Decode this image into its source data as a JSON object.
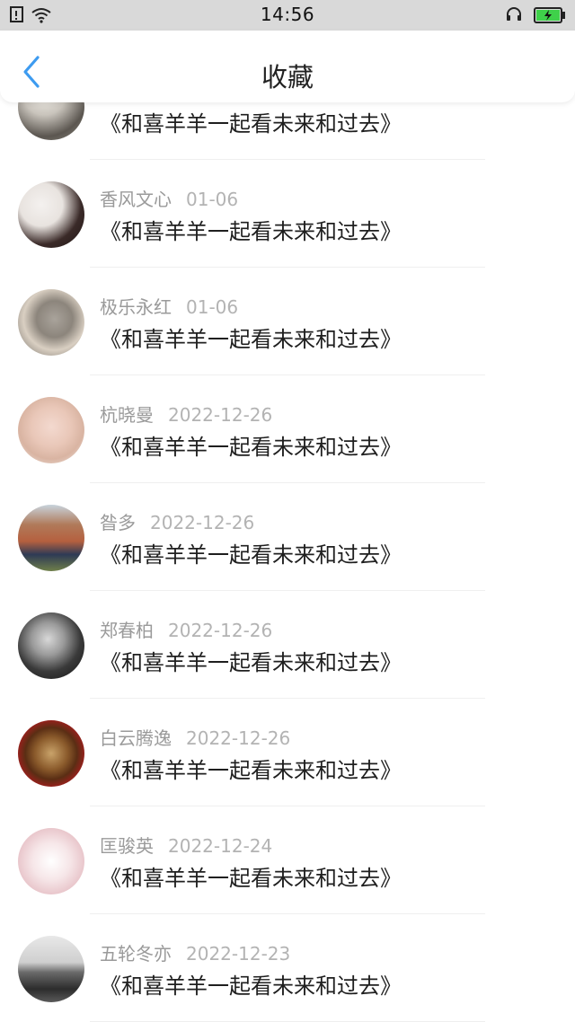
{
  "status_bar": {
    "time": "14:56"
  },
  "header": {
    "title": "收藏",
    "back_icon": "chevron-left-icon",
    "accent_color": "#3d9bf0"
  },
  "favorites": [
    {
      "name": "",
      "date": "",
      "title": "《和喜羊羊一起看未来和过去》"
    },
    {
      "name": "香风文心",
      "date": "01-06",
      "title": "《和喜羊羊一起看未来和过去》"
    },
    {
      "name": "极乐永红",
      "date": "01-06",
      "title": "《和喜羊羊一起看未来和过去》"
    },
    {
      "name": "杭晓曼",
      "date": "2022-12-26",
      "title": "《和喜羊羊一起看未来和过去》"
    },
    {
      "name": "昝多",
      "date": "2022-12-26",
      "title": "《和喜羊羊一起看未来和过去》"
    },
    {
      "name": "郑春柏",
      "date": "2022-12-26",
      "title": "《和喜羊羊一起看未来和过去》"
    },
    {
      "name": "白云腾逸",
      "date": "2022-12-26",
      "title": "《和喜羊羊一起看未来和过去》"
    },
    {
      "name": "匡骏英",
      "date": "2022-12-24",
      "title": "《和喜羊羊一起看未来和过去》"
    },
    {
      "name": "五轮冬亦",
      "date": "2022-12-23",
      "title": "《和喜羊羊一起看未来和过去》"
    }
  ]
}
